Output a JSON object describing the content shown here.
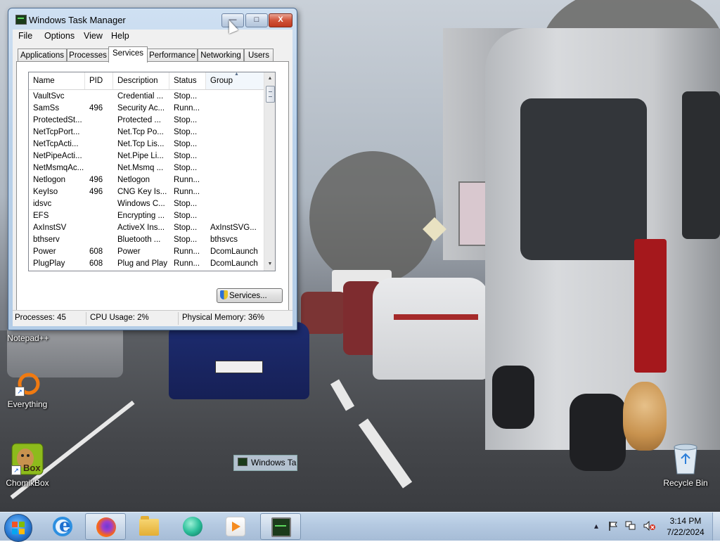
{
  "task_manager": {
    "title": "Windows Task Manager",
    "caption_buttons": {
      "minimize": "—",
      "maximize": "□",
      "close": "X"
    },
    "menu": [
      "File",
      "Options",
      "View",
      "Help"
    ],
    "tabs": [
      "Applications",
      "Processes",
      "Services",
      "Performance",
      "Networking",
      "Users"
    ],
    "active_tab": "Services",
    "columns": [
      "Name",
      "PID",
      "Description",
      "Status",
      "Group"
    ],
    "sorted_column": "Group",
    "rows": [
      {
        "name": "VaultSvc",
        "pid": "",
        "desc": "Credential ...",
        "status": "Stop...",
        "group": ""
      },
      {
        "name": "SamSs",
        "pid": "496",
        "desc": "Security Ac...",
        "status": "Runn...",
        "group": ""
      },
      {
        "name": "ProtectedSt...",
        "pid": "",
        "desc": "Protected ...",
        "status": "Stop...",
        "group": ""
      },
      {
        "name": "NetTcpPort...",
        "pid": "",
        "desc": "Net.Tcp Po...",
        "status": "Stop...",
        "group": ""
      },
      {
        "name": "NetTcpActi...",
        "pid": "",
        "desc": "Net.Tcp Lis...",
        "status": "Stop...",
        "group": ""
      },
      {
        "name": "NetPipeActi...",
        "pid": "",
        "desc": "Net.Pipe Li...",
        "status": "Stop...",
        "group": ""
      },
      {
        "name": "NetMsmqAc...",
        "pid": "",
        "desc": "Net.Msmq ...",
        "status": "Stop...",
        "group": ""
      },
      {
        "name": "Netlogon",
        "pid": "496",
        "desc": "Netlogon",
        "status": "Runn...",
        "group": ""
      },
      {
        "name": "KeyIso",
        "pid": "496",
        "desc": "CNG Key Is...",
        "status": "Runn...",
        "group": ""
      },
      {
        "name": "idsvc",
        "pid": "",
        "desc": "Windows C...",
        "status": "Stop...",
        "group": ""
      },
      {
        "name": "EFS",
        "pid": "",
        "desc": "Encrypting ...",
        "status": "Stop...",
        "group": ""
      },
      {
        "name": "AxInstSV",
        "pid": "",
        "desc": "ActiveX Ins...",
        "status": "Stop...",
        "group": "AxInstSVG..."
      },
      {
        "name": "bthserv",
        "pid": "",
        "desc": "Bluetooth ...",
        "status": "Stop...",
        "group": "bthsvcs"
      },
      {
        "name": "Power",
        "pid": "608",
        "desc": "Power",
        "status": "Runn...",
        "group": "DcomLaunch"
      },
      {
        "name": "PlugPlay",
        "pid": "608",
        "desc": "Plug and Play",
        "status": "Runn...",
        "group": "DcomLaunch"
      }
    ],
    "services_button": "Services...",
    "status_bar": {
      "processes": "Processes: 45",
      "cpu": "CPU Usage: 2%",
      "memory": "Physical Memory: 36%"
    }
  },
  "desktop": {
    "icons": [
      {
        "label": "Notepad++",
        "icon": "notepad-plus-plus-icon"
      },
      {
        "label": "Everything",
        "icon": "everything-search-icon"
      },
      {
        "label": "ChomikBox",
        "icon": "chomikbox-icon"
      },
      {
        "label": "Recycle Bin",
        "icon": "recycle-bin-icon"
      }
    ],
    "chomikbox_badge": "Box",
    "drag_ghost_label": "Windows Ta"
  },
  "taskbar": {
    "pinned": [
      "internet-explorer-icon",
      "firefox-icon",
      "file-explorer-icon",
      "browser-globe-icon",
      "media-player-icon",
      "task-manager-icon"
    ],
    "tray_icons": [
      "show-hidden-icons-arrow",
      "action-center-flag-icon",
      "network-icon",
      "volume-muted-icon"
    ],
    "clock_time": "3:14 PM",
    "clock_date": "7/22/2024"
  },
  "colors": {
    "window_frame": "#b9d1ea",
    "close_button": "#c03a20",
    "taskbar": "#b4c9e1"
  }
}
